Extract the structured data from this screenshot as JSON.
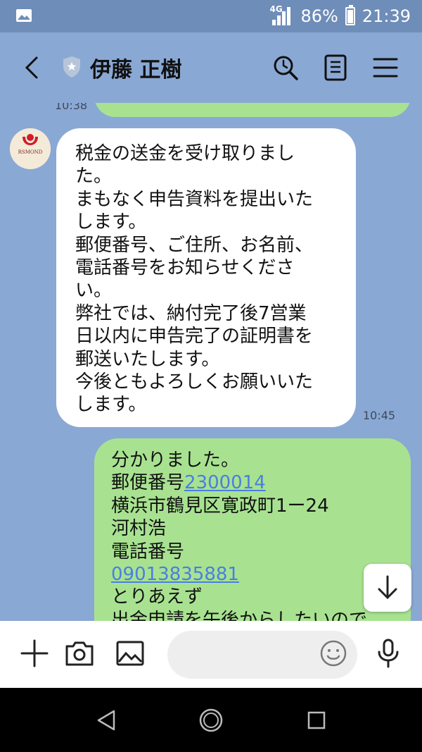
{
  "status": {
    "network": "4G",
    "battery": "86%",
    "battery_level": 0.86,
    "time": "21:39"
  },
  "header": {
    "title": "伊藤 正樹"
  },
  "messages": [
    {
      "sender_logo_text": "RSMOND",
      "lines": [
        "税金の送金を受け取りまし",
        "た。",
        "まもなく申告資料を提出いた",
        "します。",
        "郵便番号、ご住所、お名前、",
        "電話番号をお知らせくださ",
        "い。",
        "弊社では、納付完了後7営業",
        "日以内に申告完了の証明書を",
        "郵送いたします。",
        "今後ともよろしくお願いいた",
        "します。"
      ],
      "time": "10:45"
    },
    {
      "line1": "分かりました。",
      "line2_prefix": "郵便番号",
      "postal_link": "2300014",
      "line3": "横浜市鶴見区寛政町1ー24",
      "line4": "河村浩",
      "line5": "電話番号",
      "phone_link": "09013835881",
      "line7": "とりあえず",
      "line8": "出金申請を午後からしたいので"
    }
  ],
  "previous_time": "10:38",
  "input": {
    "placeholder": ""
  },
  "colors": {
    "chat_bg": "#8aa8d4",
    "outgoing_bubble": "#a8e291",
    "incoming_bubble": "#ffffff",
    "link": "#4a7fe0"
  }
}
